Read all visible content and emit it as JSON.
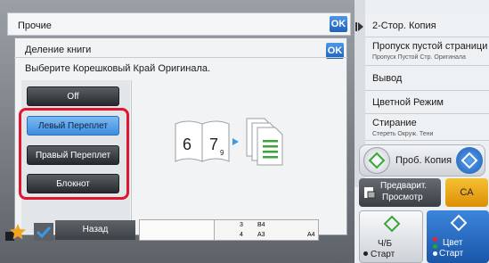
{
  "header": {
    "back_dialog_title": "Прочие",
    "ok_label": "OK"
  },
  "dialog": {
    "title": "Деление книги",
    "ok_label": "OK",
    "instruction": "Выберите Корешковый Край Оригинала.",
    "options": [
      {
        "label": "Off",
        "selected": false
      },
      {
        "label": "Левый Переплет",
        "selected": true
      },
      {
        "label": "Правый Переплет",
        "selected": false
      },
      {
        "label": "Блокнот",
        "selected": false
      }
    ],
    "illustration": {
      "page_numbers": [
        "6",
        "7",
        "9"
      ]
    }
  },
  "side_panel": {
    "items": [
      {
        "title": "2-Стор. Копия",
        "subtitle": ""
      },
      {
        "title": "Пропуск пустой страници",
        "subtitle": "Пропуск Пустой Стр. Оригинала"
      },
      {
        "title": "Вывод",
        "subtitle": ""
      },
      {
        "title": "Цветной Режим",
        "subtitle": ""
      },
      {
        "title": "Стирание",
        "subtitle": "Стереть Окруж. Тени"
      }
    ],
    "proof_copy_label": "Проб. Копия",
    "preview_label_line1": "Предварит.",
    "preview_label_line2": "Просмотр",
    "ca_label": "CA",
    "start_bw_label_line1": "Ч/Б",
    "start_bw_label_line2": "Старт",
    "start_color_label_line1": "Цвет",
    "start_color_label_line2": "Старт"
  },
  "bottom_bar": {
    "back_label": "Назад",
    "paper_labels": [
      "3",
      "B4",
      "4",
      "A3",
      "A4"
    ]
  },
  "colors": {
    "accent_blue": "#3d8ddf",
    "highlight_red": "#e0152e",
    "ca_orange": "#f6c033",
    "start_color_blue": "#1a56a8"
  },
  "icons": [
    "arrow-right-icon",
    "star-icon",
    "check-icon",
    "proof-copy-icon",
    "preview-icon",
    "start-icon",
    "book-icon",
    "pages-icon"
  ]
}
